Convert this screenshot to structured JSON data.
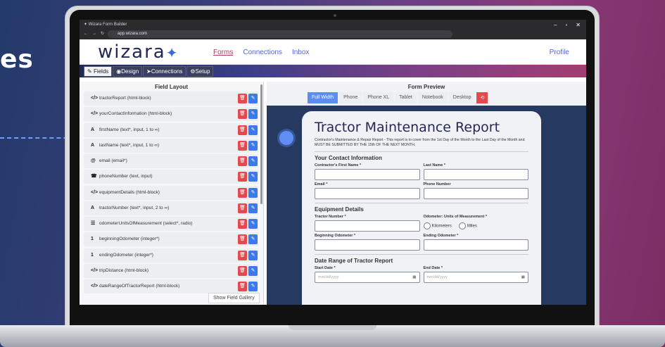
{
  "hero_text": "es",
  "browser": {
    "tab_title": "Wizara Form Builder",
    "url": "app.wizara.com"
  },
  "app": {
    "logo": "wizara",
    "nav": [
      "Forms",
      "Connections",
      "Inbox"
    ],
    "profile": "Profile"
  },
  "builder_tabs": [
    "Fields",
    "Design",
    "Connections",
    "Setup"
  ],
  "field_layout": {
    "title": "Field Layout",
    "fields": [
      {
        "icon": "</>",
        "label": "tractorReport (html-block)"
      },
      {
        "icon": "</>",
        "label": "yourContactInformation (html-block)"
      },
      {
        "icon": "A",
        "label": "firstName (text*, input, 1 to ∞)"
      },
      {
        "icon": "A",
        "label": "lastName (text*, input, 1 to ∞)"
      },
      {
        "icon": "@",
        "label": "email (email*)"
      },
      {
        "icon": "☎",
        "label": "phoneNumber (text, input)"
      },
      {
        "icon": "</>",
        "label": "equipmentDetails (html-block)"
      },
      {
        "icon": "A",
        "label": "tractorNumber (text*, input, 2 to ∞)"
      },
      {
        "icon": "☰",
        "label": "odometerUnitsOfMeasurement (select*, radio)"
      },
      {
        "icon": "1",
        "label": "beginningOdometer (integer*)"
      },
      {
        "icon": "1",
        "label": "endingOdometer (integer*)"
      },
      {
        "icon": "</>",
        "label": "tripDistance (html-block)"
      },
      {
        "icon": "</>",
        "label": "dateRangeOfTractorReport (html-block)"
      }
    ],
    "gallery_button": "Show Field Gallery"
  },
  "preview": {
    "title": "Form Preview",
    "devices": [
      "Full Width",
      "Phone",
      "Phone XL",
      "Tablet",
      "Notebook",
      "Desktop"
    ],
    "active_device": "Full Width"
  },
  "form": {
    "title": "Tractor Maintenance Report",
    "description": "Contractor's Maintenance & Repair Report - This report is to cover from the 1st Day of the Month to the Last Day of the Month and MUST BE SUBMITTED BY THE 15th OF THE NEXT MONTH.",
    "sec_contact": "Your Contact Information",
    "first_name": "Contractor's First Name *",
    "last_name": "Last Name *",
    "email": "Email *",
    "phone": "Phone Number",
    "sec_equipment": "Equipment Details",
    "tractor_number": "Tractor Number *",
    "odometer_units": "Odometer: Units of Measurement *",
    "radio_km": "Kilometers",
    "radio_miles": "Miles",
    "beginning_odometer": "Beginning Odometer *",
    "ending_odometer": "Ending Odometer *",
    "sec_dates": "Date Range of Tractor Report",
    "start_date": "Start Date *",
    "end_date": "End Date *",
    "date_placeholder": "mm/dd/yyyy"
  }
}
